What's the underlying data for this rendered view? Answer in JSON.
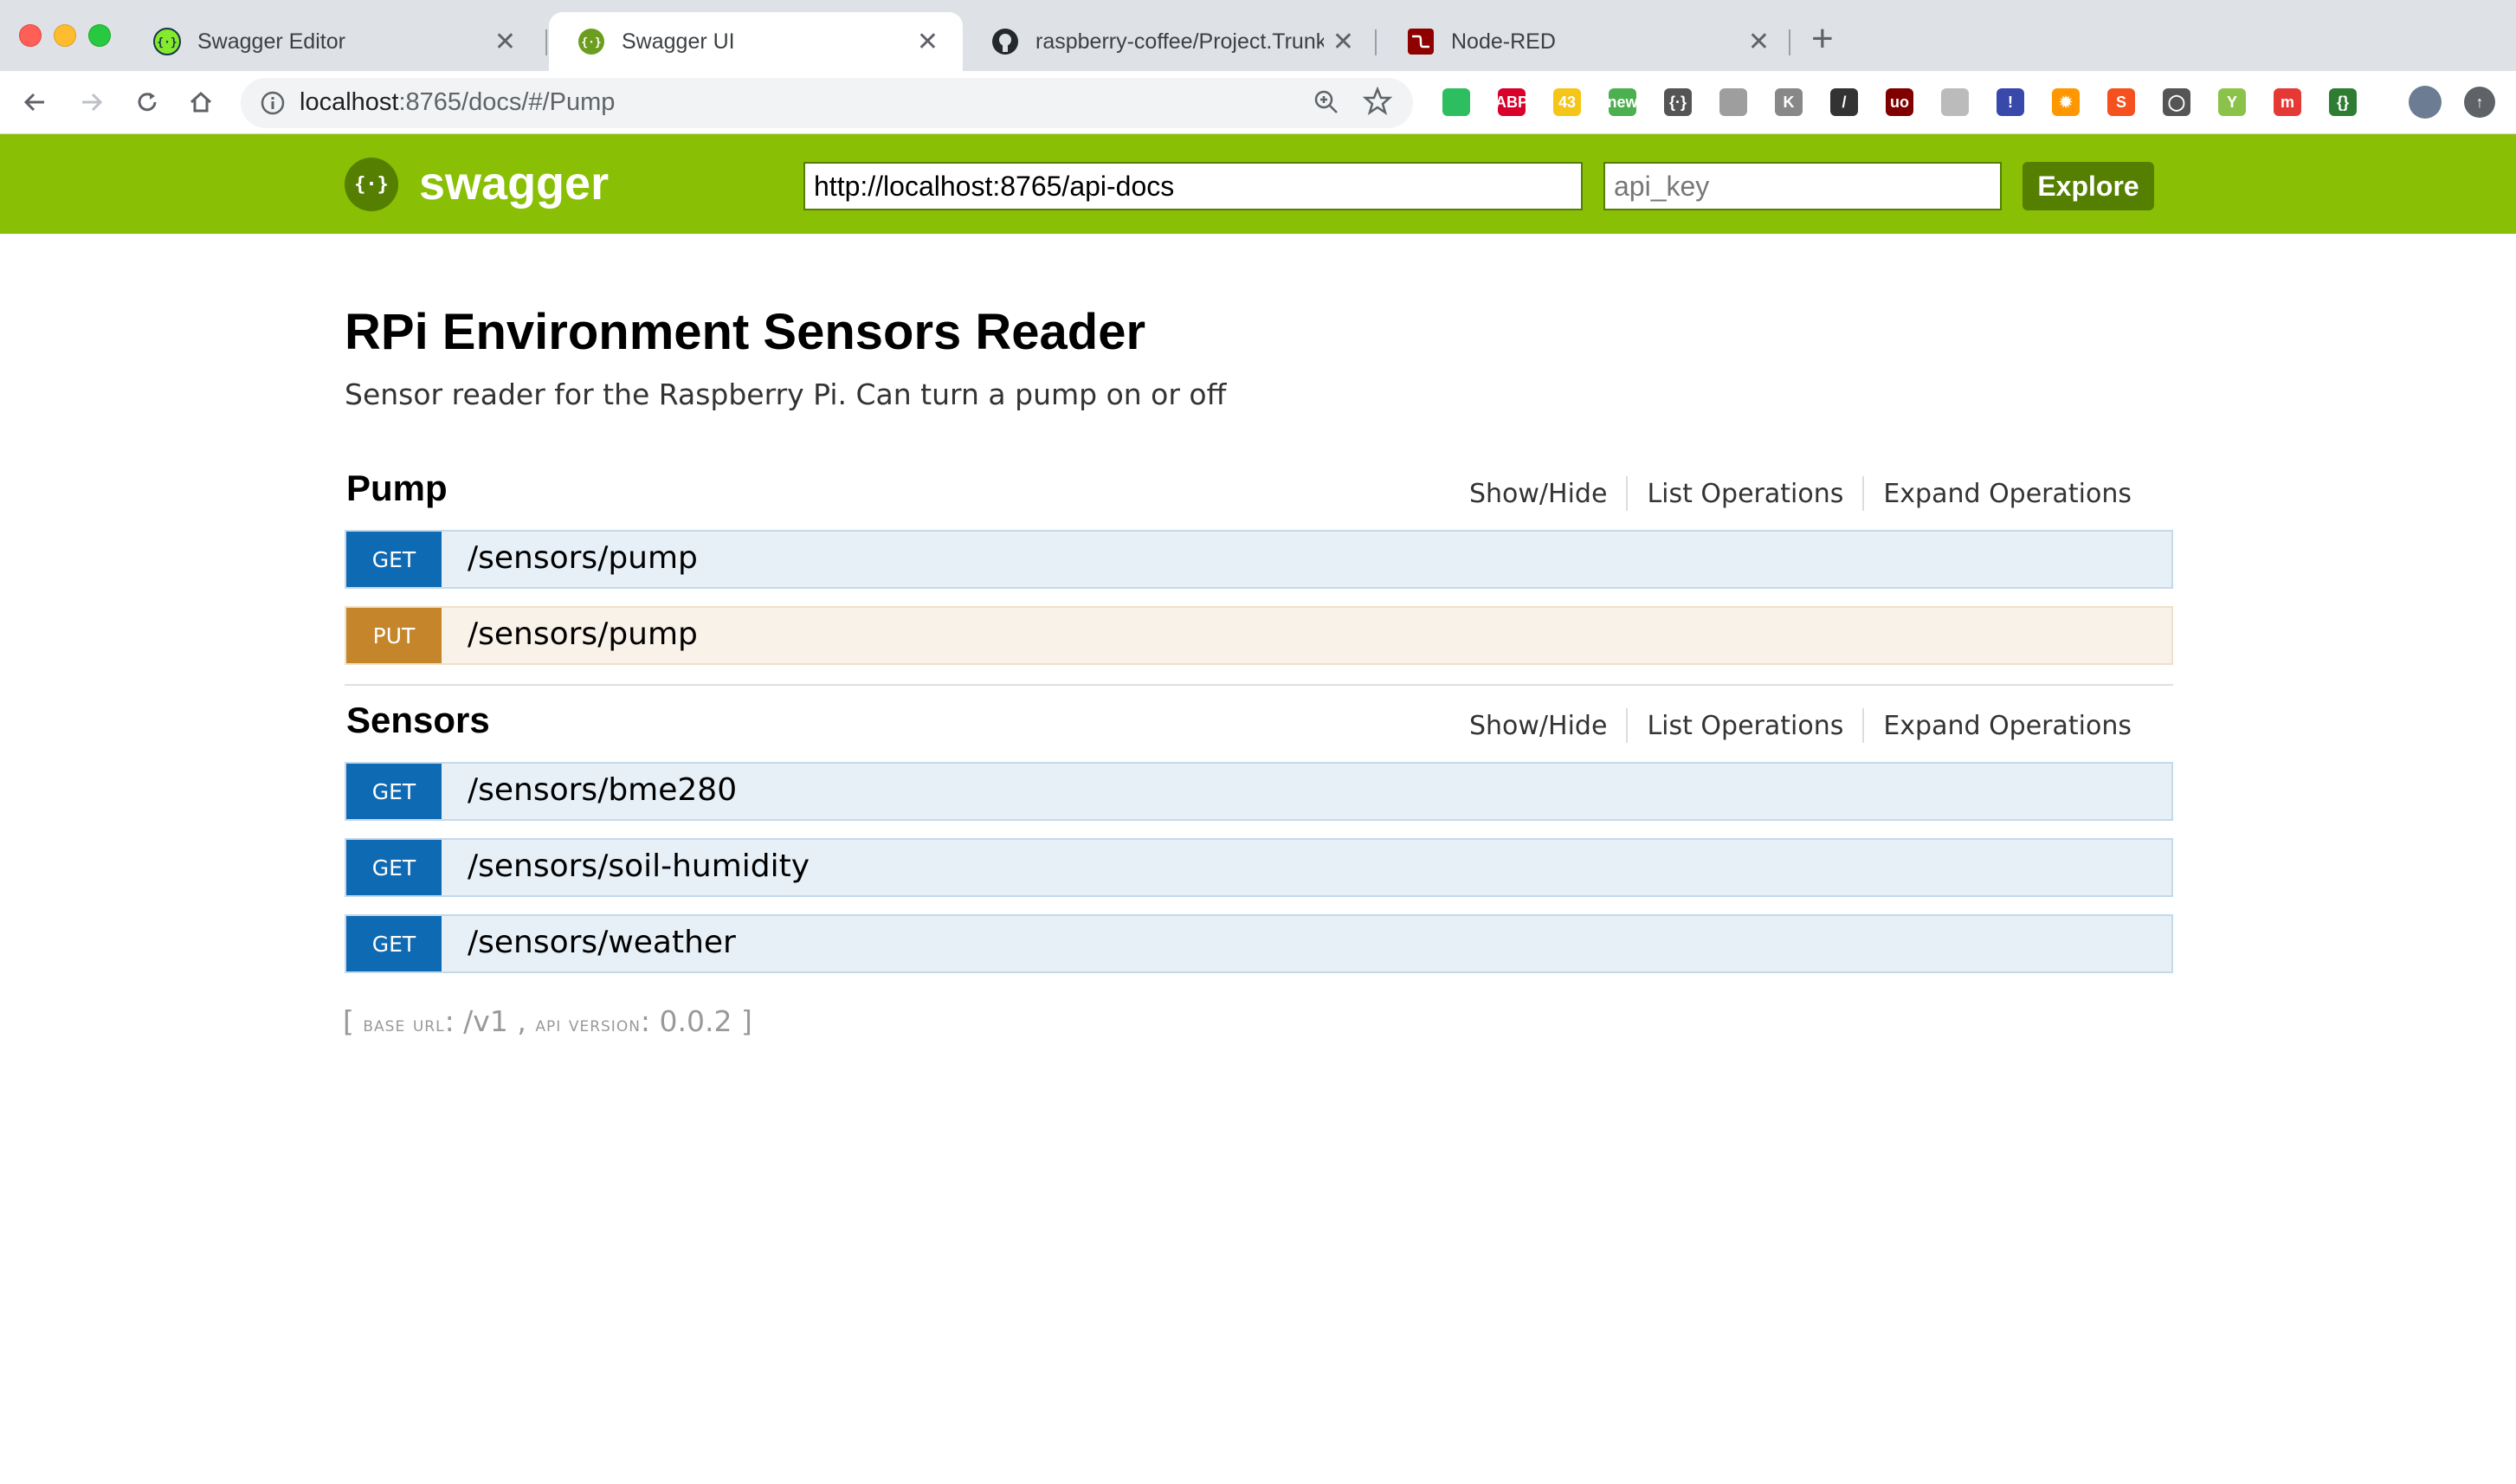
{
  "browser": {
    "tabs": [
      {
        "title": "Swagger Editor",
        "icon": "swagger-icon",
        "active": false
      },
      {
        "title": "Swagger UI",
        "icon": "swagger-icon",
        "active": true
      },
      {
        "title": "raspberry-coffee/Project.Trunk",
        "icon": "github-icon",
        "active": false
      },
      {
        "title": "Node-RED",
        "icon": "node-red-icon",
        "active": false
      }
    ],
    "address": {
      "host": "localhost",
      "rest": ":8765/docs/#/Pump"
    },
    "extensions": [
      {
        "name": "evernote-icon",
        "color": "#2dbe60",
        "glyph": ""
      },
      {
        "name": "adblock-plus-icon",
        "color": "#d9002b",
        "glyph": "ABP"
      },
      {
        "name": "weather-icon",
        "color": "#f5c518",
        "glyph": "43"
      },
      {
        "name": "new-badge-icon",
        "color": "#4caf50",
        "glyph": "new"
      },
      {
        "name": "swagger-ext-icon",
        "color": "#555555",
        "glyph": "{·}"
      },
      {
        "name": "box-icon",
        "color": "#9e9e9e",
        "glyph": ""
      },
      {
        "name": "k-icon",
        "color": "#888888",
        "glyph": "K"
      },
      {
        "name": "terminal-icon",
        "color": "#333333",
        "glyph": "/"
      },
      {
        "name": "ublock-icon",
        "color": "#800000",
        "glyph": "uo"
      },
      {
        "name": "circle-icon",
        "color": "#bbbbbb",
        "glyph": ""
      },
      {
        "name": "flag-icon",
        "color": "#3949ab",
        "glyph": "!"
      },
      {
        "name": "gear-ext-icon",
        "color": "#ff9800",
        "glyph": "✹"
      },
      {
        "name": "swirl-icon",
        "color": "#f4511e",
        "glyph": "S"
      },
      {
        "name": "bulb-icon",
        "color": "#555555",
        "glyph": "◯"
      },
      {
        "name": "plant-icon",
        "color": "#8bc34a",
        "glyph": "Y"
      },
      {
        "name": "m-icon",
        "color": "#e53935",
        "glyph": "m"
      },
      {
        "name": "json-icon",
        "color": "#2e7d32",
        "glyph": "{}"
      }
    ]
  },
  "swagger": {
    "brand": "swagger",
    "url_value": "http://localhost:8765/api-docs",
    "api_key_placeholder": "api_key",
    "explore_label": "Explore"
  },
  "api": {
    "title": "RPi Environment Sensors Reader",
    "description": "Sensor reader for the Raspberry Pi. Can turn a pump on or off"
  },
  "section_links": {
    "show_hide": "Show/Hide",
    "list_operations": "List Operations",
    "expand_operations": "Expand Operations"
  },
  "sections": [
    {
      "name": "Pump",
      "operations": [
        {
          "method": "GET",
          "path": "/sensors/pump"
        },
        {
          "method": "PUT",
          "path": "/sensors/pump"
        }
      ]
    },
    {
      "name": "Sensors",
      "operations": [
        {
          "method": "GET",
          "path": "/sensors/bme280"
        },
        {
          "method": "GET",
          "path": "/sensors/soil-humidity"
        },
        {
          "method": "GET",
          "path": "/sensors/weather"
        }
      ]
    }
  ],
  "footer": {
    "open": "[ ",
    "base_url_label": "base url",
    "base_url": "/v1",
    "api_version_label": "api version",
    "api_version": "0.0.2",
    "close": " ]"
  },
  "colors": {
    "swagger_green": "#89bf04",
    "swagger_dark_green": "#547f00",
    "get_blue": "#0f6ab4",
    "put_orange": "#c5862b"
  }
}
